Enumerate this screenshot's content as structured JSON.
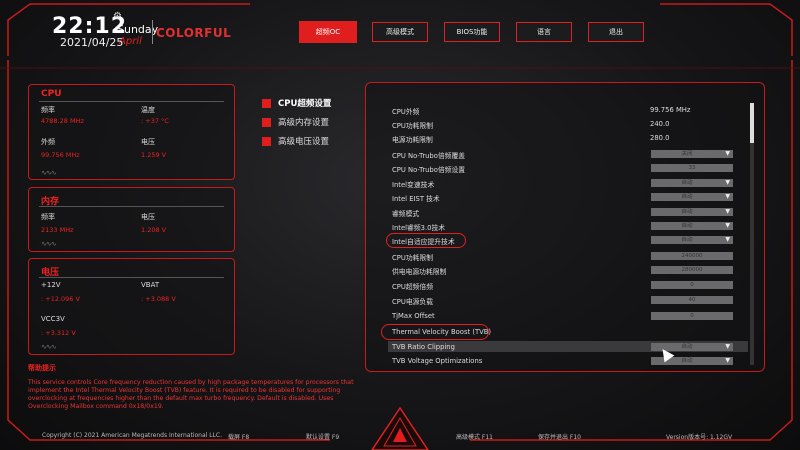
{
  "header": {
    "time": "22:12",
    "day": "Sunday",
    "month": "April",
    "date": "2021/04/25",
    "brand": "COLORFUL",
    "nav": [
      "超频OC",
      "高级模式",
      "BIOS功能",
      "语言",
      "退出"
    ]
  },
  "cpu_panel": {
    "title": "CPU",
    "freq_label": "频率",
    "freq_value": "4788.28 MHz",
    "temp_label": "温度",
    "temp_value": ": +37 °C",
    "bclk_label": "外频",
    "bclk_value": "99.756 MHz",
    "volt_label": "电压",
    "volt_value": "1.259 V"
  },
  "mem_panel": {
    "title": "内存",
    "freq_label": "频率",
    "freq_value": "2133 MHz",
    "volt_label": "电压",
    "volt_value": "1.208 V"
  },
  "volt_panel": {
    "title": "电压",
    "v12_label": "+12V",
    "v12_value": ": +12.096 V",
    "vbat_label": "VBAT",
    "vbat_value": ": +3.088 V",
    "vcc3_label": "VCC3V",
    "vcc3_value": ": +3.312 V"
  },
  "submenu": [
    "CPU超频设置",
    "高级内存设置",
    "高级电压设置"
  ],
  "settings": [
    {
      "label": "CPU外频",
      "value": "99.756 MHz"
    },
    {
      "label": "CPU功耗限制",
      "value": "240.0"
    },
    {
      "label": "电源功耗限制",
      "value": "280.0"
    },
    {
      "label": "CPU No-Trubo倍频覆盖",
      "value": "关闭"
    },
    {
      "label": "CPU No-Trubo倍频设置",
      "value": "33"
    },
    {
      "label": "Intel变速技术",
      "value": "自动"
    },
    {
      "label": "Intel EIST 技术",
      "value": "自动"
    },
    {
      "label": "睿频模式",
      "value": "自动"
    },
    {
      "label": "Intel睿频3.0技术",
      "value": "自动"
    },
    {
      "label": "Intel自适应提升技术",
      "value": "自动"
    },
    {
      "label": "CPU功耗限制",
      "value": "240000"
    },
    {
      "label": "供电电源功耗限制",
      "value": "280000"
    },
    {
      "label": "CPU超频倍频",
      "value": "0"
    },
    {
      "label": "CPU电源负载",
      "value": "40"
    },
    {
      "label": "TjMax Offset",
      "value": "0"
    },
    {
      "label": "Thermal Velocity Boost (TVB)",
      "value": ""
    },
    {
      "label": "TVB Ratio Clipping",
      "value": "自动"
    },
    {
      "label": "TVB Voltage Optimizations",
      "value": "自动"
    }
  ],
  "help": {
    "title": "帮助提示",
    "text": "This service controls Core frequency reduction caused by high package temperatures for processors that implement the Intel Thermal Velocity Boost (TVB) feature. It is required to be disabled for supporting overclocking at frequencies higher than the default max turbo frequency. Default is disabled. Uses Overclocking Mailbox command 0x18/0x19."
  },
  "footer": {
    "copyright": "Copyright (C) 2021 American Megatrends International LLC.",
    "save_exit": "载屏 F8",
    "defaults": "默认设置 F9",
    "advanced": "高级模式 F11",
    "save": "保存并退出 F10",
    "version": "Version版本号: 1.12GV"
  },
  "colors": {
    "accent": "#e01e1e",
    "frame": "#c81a1a"
  }
}
